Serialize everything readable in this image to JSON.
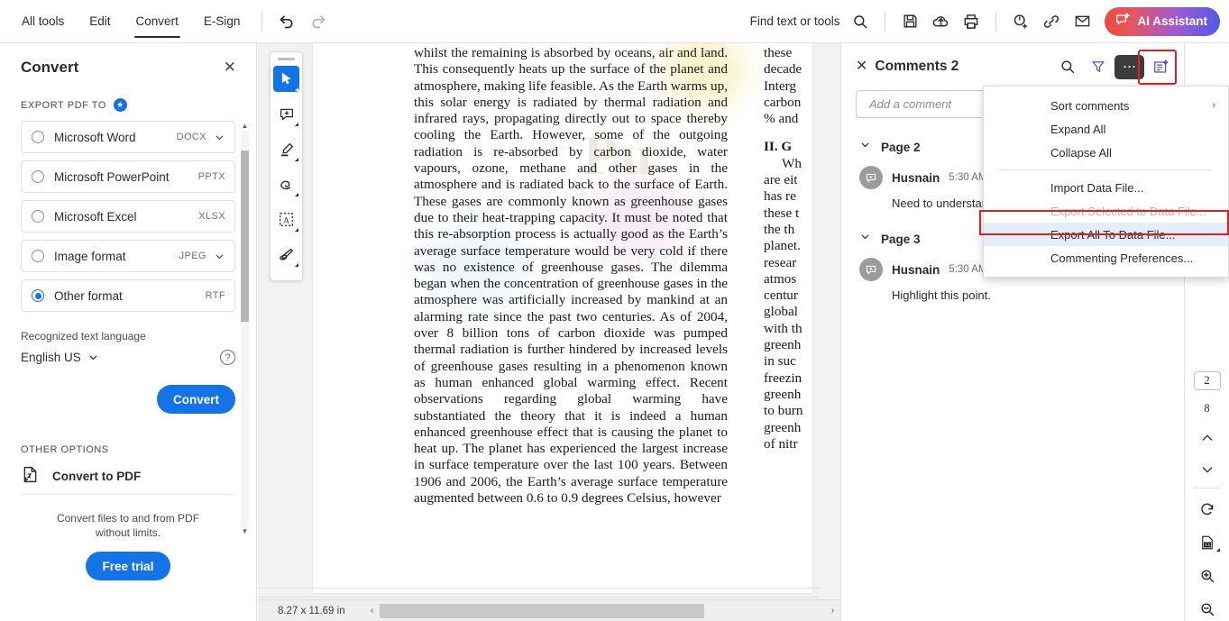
{
  "topbar": {
    "tabs": [
      {
        "label": "All tools",
        "active": false
      },
      {
        "label": "Edit",
        "active": false
      },
      {
        "label": "Convert",
        "active": true
      },
      {
        "label": "E-Sign",
        "active": false
      }
    ],
    "undo_name": "undo-icon",
    "redo_name": "redo-icon",
    "find_label": "Find text or tools",
    "icons": [
      "save-icon",
      "upload-to-cloud-icon",
      "print-icon",
      "add-stamp-icon",
      "link-icon",
      "email-icon"
    ],
    "ai_button": "AI Assistant"
  },
  "convert_panel": {
    "title": "Convert",
    "close_label": "✕",
    "export_label": "EXPORT PDF TO",
    "formats": [
      {
        "name": "Microsoft Word",
        "ext": "DOCX",
        "selected": false,
        "has_chevron": true
      },
      {
        "name": "Microsoft PowerPoint",
        "ext": "PPTX",
        "selected": false,
        "has_chevron": false
      },
      {
        "name": "Microsoft Excel",
        "ext": "XLSX",
        "selected": false,
        "has_chevron": false
      },
      {
        "name": "Image format",
        "ext": "JPEG",
        "selected": false,
        "has_chevron": true
      },
      {
        "name": "Other format",
        "ext": "RTF",
        "selected": true,
        "has_chevron": false
      }
    ],
    "language_label": "Recognized text language",
    "language_value": "English US",
    "help_glyph": "?",
    "convert_button": "Convert",
    "other_options_label": "OTHER OPTIONS",
    "convert_to_pdf": "Convert to PDF",
    "promo_line1": "Convert files to and from PDF",
    "promo_line2": "without limits.",
    "free_trial_button": "Free trial"
  },
  "tool_rail": {
    "tools": [
      {
        "name": "select-tool",
        "active": true
      },
      {
        "name": "add-comment-tool",
        "active": false
      },
      {
        "name": "highlight-tool",
        "active": false
      },
      {
        "name": "draw-oval-tool",
        "active": false
      },
      {
        "name": "select-text-area-tool",
        "active": false
      },
      {
        "name": "stamp-tool",
        "active": false
      }
    ]
  },
  "document": {
    "left_column": "whilst the remaining is absorbed by oceans, air and land. This consequently heats up the surface of the planet and atmosphere, making life feasible. As the Earth warms up, this solar energy is radiated by thermal radiation and infrared rays, propagating directly out to space thereby cooling the Earth. However, some of the outgoing radiation is re-absorbed by carbon dioxide, water vapours, ozone, methane and other gases in the atmosphere and is radiated back to the surface of Earth. These gases are commonly known as greenhouse gases due to their heat-trapping capacity. It must be noted that this re-absorption process is actually good as the Earth’s average surface temperature would be very cold if there was no existence of greenhouse gases. The dilemma began when the concentration of greenhouse gases in the atmosphere was artificially increased by mankind at an alarming rate since the past two centuries. As of 2004, over 8 billion tons of carbon dioxide was pumped thermal radiation is further hindered by increased levels of greenhouse gases resulting in a phenomenon known as human enhanced global warming effect. Recent observations regarding global warming have substantiated the theory that it is indeed a human enhanced greenhouse effect that is causing the planet to heat up. The planet has experienced the largest increase in surface temperature over the last 100 years. Between 1906 and 2006, the Earth’s average surface temperature augmented between 0.6 to 0.9 degrees Celsius, however",
    "right_column_lines": [
      "these",
      "decade",
      "Interg",
      "carbon",
      "% and"
    ],
    "right_heading": "II. G",
    "right_column_lines2": [
      "Wh",
      "are eit",
      "has re",
      "these t",
      "the th",
      "planet.",
      "resear",
      "atmos",
      "centur",
      "global",
      "with th",
      "greenh",
      "in suc",
      "freezin",
      "greenh",
      "to burn",
      "greenh",
      "of nitr"
    ],
    "watermark": "Pu",
    "comment_pin_name": "comment-pin-marker"
  },
  "statusbar": {
    "page_dimensions": "8.27 x 11.69 in",
    "left_arrow": "‹",
    "right_arrow": "›"
  },
  "comments_panel": {
    "title": "Comments 2",
    "close_label": "✕",
    "search_icon": "search-icon",
    "filter_icon": "filter-icon",
    "more_icon": "more-options-icon",
    "export_panel_icon": "export-comments-icon",
    "input_placeholder": "Add a comment",
    "groups": [
      {
        "page_label": "Page 2",
        "comments": [
          {
            "author": "Husnain",
            "time": "5:30 AM",
            "text": "Need to understand"
          }
        ]
      },
      {
        "page_label": "Page 3",
        "comments": [
          {
            "author": "Husnain",
            "time": "5:30 AM",
            "text": "Highlight this point."
          }
        ]
      }
    ]
  },
  "menu": {
    "items": [
      {
        "label": "Sort comments",
        "submenu": true,
        "disabled": false,
        "highlighted": false
      },
      {
        "label": "Expand All",
        "submenu": false,
        "disabled": false,
        "highlighted": false
      },
      {
        "label": "Collapse All",
        "submenu": false,
        "disabled": false,
        "highlighted": false
      },
      {
        "separator": true
      },
      {
        "label": "Import Data File...",
        "submenu": false,
        "disabled": false,
        "highlighted": false
      },
      {
        "label": "Export Selected to Data File...",
        "submenu": false,
        "disabled": true,
        "highlighted": false
      },
      {
        "label": "Export All To Data File...",
        "submenu": false,
        "disabled": false,
        "highlighted": true
      },
      {
        "label": "Commenting Preferences...",
        "submenu": false,
        "disabled": false,
        "highlighted": false
      }
    ],
    "submenu_arrow": "›",
    "overlap_number": "1"
  },
  "right_rail": {
    "current_page": "2",
    "total_pages": "8",
    "prev_page_icon": "chevron-up-icon",
    "next_page_icon": "chevron-down-icon",
    "rotate_icon": "rotate-clockwise-icon",
    "fit_page_icon": "actual-size-icon",
    "zoom_in_icon": "zoom-in-icon",
    "zoom_out_icon": "zoom-out-icon"
  },
  "colors": {
    "accent_blue": "#1473e6",
    "highlight_red": "#e02020",
    "menu_highlight": "#e4eefb",
    "comment_pin": "#9b30d9"
  }
}
